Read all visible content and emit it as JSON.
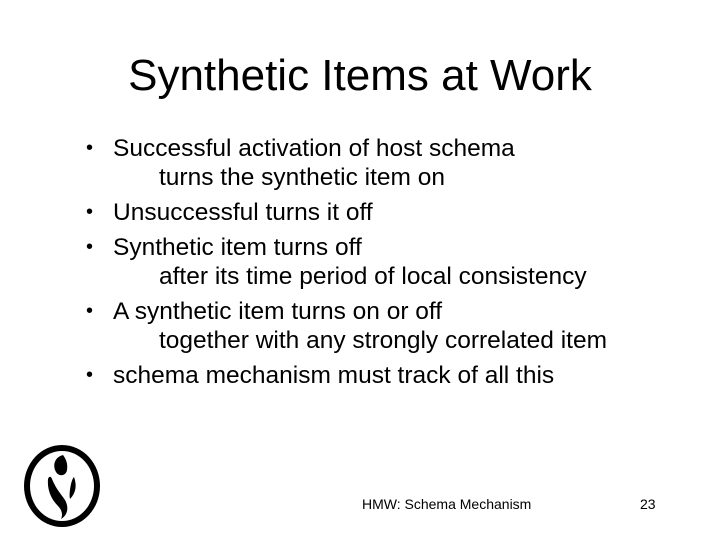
{
  "slide": {
    "title": "Synthetic Items at Work",
    "bullets": [
      {
        "main": "Successful activation of host schema",
        "sub": "turns the synthetic item on"
      },
      {
        "main": "Unsuccessful turns it off",
        "sub": ""
      },
      {
        "main": "Synthetic item turns off",
        "sub": "after its time period of local consistency"
      },
      {
        "main": "A synthetic item turns on or off",
        "sub": "together with any strongly correlated item"
      },
      {
        "main": "schema mechanism must track of all this",
        "sub": ""
      }
    ],
    "bullet_symbol": "•",
    "logo_icon": "stylized-figure-logo-icon",
    "footer_text": "HMW: Schema Mechanism",
    "page_number": "23"
  }
}
